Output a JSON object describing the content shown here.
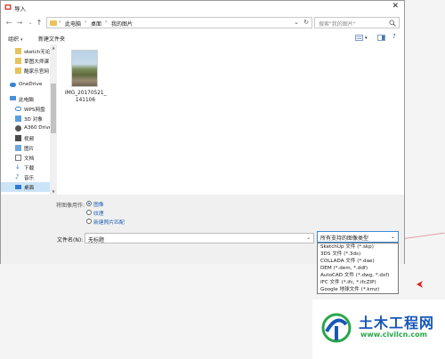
{
  "window": {
    "title": "导入"
  },
  "address": {
    "crumbs": [
      "此电脑",
      "桌面",
      "我的图片"
    ]
  },
  "search": {
    "placeholder": "搜索\"我的图片\""
  },
  "toolbar": {
    "organize": "组织",
    "new_folder": "新建文件夹"
  },
  "sidebar": {
    "items": [
      {
        "label": "sketch无论",
        "icon": "folder-icon"
      },
      {
        "label": "草图大师课",
        "icon": "folder-icon"
      },
      {
        "label": "酷家乐官网",
        "icon": "folder-icon"
      },
      {
        "label": "OneDrive",
        "icon": "cloud-icon"
      },
      {
        "label": "此电脑",
        "icon": "computer-icon"
      },
      {
        "label": "WPS网盘",
        "icon": "cloud-icon"
      },
      {
        "label": "3D 对象",
        "icon": "cube-icon"
      },
      {
        "label": "A360 Drive",
        "icon": "drive-icon"
      },
      {
        "label": "视频",
        "icon": "video-icon"
      },
      {
        "label": "图片",
        "icon": "picture-icon"
      },
      {
        "label": "文档",
        "icon": "document-icon"
      },
      {
        "label": "下载",
        "icon": "download-icon"
      },
      {
        "label": "音乐",
        "icon": "music-icon"
      },
      {
        "label": "桌面",
        "icon": "desktop-icon"
      }
    ],
    "selected_index": 13
  },
  "files": [
    {
      "name_line1": "IMG_20170521_",
      "name_line2": "141106"
    }
  ],
  "options": {
    "label": "将图像用作:",
    "radios": [
      {
        "label": "图像",
        "selected": true
      },
      {
        "label": "纹理",
        "selected": false
      },
      {
        "label": "新建照片匹配",
        "selected": false
      }
    ]
  },
  "filename": {
    "label": "文件名(N):",
    "value": "无标题"
  },
  "filetype": {
    "selected": "所有支持的图像类型",
    "options": [
      "SketchUp 文件 (*.skp)",
      "3DS 文件 (*.3ds)",
      "COLLADA 文件 (*.dae)",
      "DEM (*.dem, *.ddf)",
      "AutoCAD 文件 (*.dwg, *.dxf)",
      "IFC 文件 (*.ifc, *.ifcZIP)",
      "Google 地球文件 (*.kmz)"
    ]
  },
  "watermark": {
    "title": "土木工程网",
    "url": "www.civilcn.com"
  },
  "colors": {
    "accent": "#1a73d0",
    "link": "#1f5fb5",
    "selection": "#cce4f7",
    "brand_blue": "#1757b8",
    "brand_green": "#2aa64a"
  }
}
